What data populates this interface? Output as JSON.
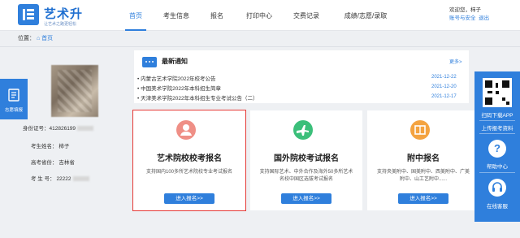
{
  "header": {
    "logo_name": "艺术升",
    "logo_sub": "让艺术之路更轻松",
    "nav": [
      "首页",
      "考生信息",
      "报名",
      "打印中心",
      "交费记录",
      "成绩/志愿/录取"
    ],
    "greeting": "欢迎您，",
    "user_name": "柿子",
    "account_security": "账号与安全",
    "logout": "退出"
  },
  "breadcrumb": {
    "prefix": "位置：",
    "home": "首页"
  },
  "left_float": {
    "label": "志愿填报"
  },
  "profile": {
    "id_label": "身份证号：",
    "id_value": "412826199",
    "name_label": "考生姓名：",
    "name_value": "柿子",
    "province_label": "高考省份：",
    "province_value": "吉林省",
    "exam_label": "考  生  号：",
    "exam_value": "22222"
  },
  "news": {
    "title": "最新通知",
    "more": "更多>",
    "items": [
      {
        "text": "内蒙古艺术学院2022年校考公告",
        "date": "2021-12-22"
      },
      {
        "text": "中国美术学院2022年本科招生简章",
        "date": "2021-12-20"
      },
      {
        "text": "天津美术学院2022年本科招生专业考试公告（二）",
        "date": "2021-12-17"
      }
    ]
  },
  "cards": [
    {
      "title": "艺术院校校考报名",
      "desc": "支持国内100多所艺术院校专业考试报名",
      "button": "进入报名>>",
      "color": "#ef8f86"
    },
    {
      "title": "国外院校考试报名",
      "desc": "支持国际艺术、中外合作及海外50多所艺术名校中国区选拔考试报名",
      "button": "进入报名>>",
      "color": "#3bbf7a"
    },
    {
      "title": "附中报名",
      "desc": "支持央美附中、国美附中、西美附中、广美附中、山工艺附中......",
      "button": "进入报名>>",
      "color": "#f4a340"
    }
  ],
  "right_bar": {
    "download_app": "扫码下载APP",
    "upload": "上传报考资料",
    "help_center": "帮助中心",
    "online_service": "在线客服"
  },
  "colors": {
    "primary": "#2f7fdc",
    "highlight": "#e53935"
  }
}
